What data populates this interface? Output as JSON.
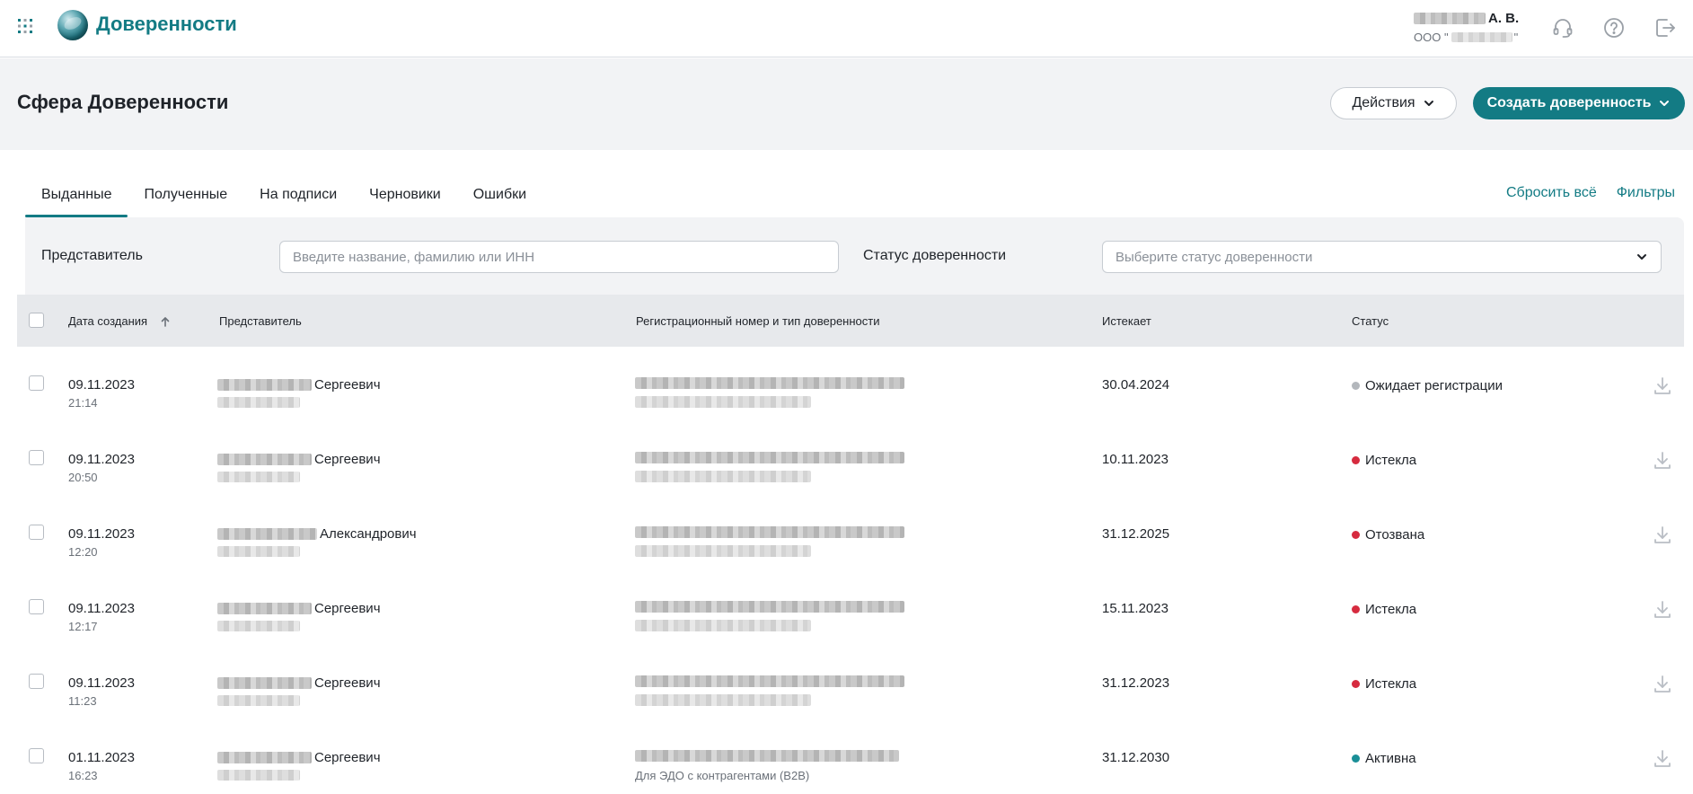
{
  "app": {
    "title": "Доверенности",
    "user_initials": "А. В.",
    "org_prefix": "ООО \""
  },
  "header": {
    "page_title": "Сфера Доверенности",
    "actions_label": "Действия",
    "create_label": "Создать доверенность"
  },
  "tabs": [
    {
      "label": "Выданные",
      "active": true
    },
    {
      "label": "Полученные",
      "active": false
    },
    {
      "label": "На подписи",
      "active": false
    },
    {
      "label": "Черновики",
      "active": false
    },
    {
      "label": "Ошибки",
      "active": false
    }
  ],
  "links": {
    "reset_all": "Сбросить всё",
    "filters": "Фильтры"
  },
  "filters": {
    "representative_label": "Представитель",
    "representative_placeholder": "Введите название, фамилию или ИНН",
    "status_label": "Статус доверенности",
    "status_placeholder": "Выберите статус доверенности"
  },
  "table": {
    "columns": {
      "created": "Дата создания",
      "representative": "Представитель",
      "reg_number": "Регистрационный номер и тип доверенности",
      "expires": "Истекает",
      "status": "Статус"
    },
    "rows": [
      {
        "date": "09.11.2023",
        "time": "21:14",
        "rep_patronymic": "Сергеевич",
        "reg_type": "",
        "expires": "30.04.2024",
        "status": "Ожидает регистрации",
        "status_color": "#b3b7bc"
      },
      {
        "date": "09.11.2023",
        "time": "20:50",
        "rep_patronymic": "Сергеевич",
        "reg_type": "",
        "expires": "10.11.2023",
        "status": "Истекла",
        "status_color": "#d62b3f"
      },
      {
        "date": "09.11.2023",
        "time": "12:20",
        "rep_patronymic": "Александрович",
        "reg_type": "",
        "expires": "31.12.2025",
        "status": "Отозвана",
        "status_color": "#d62b3f"
      },
      {
        "date": "09.11.2023",
        "time": "12:17",
        "rep_patronymic": "Сергеевич",
        "reg_type": "",
        "expires": "15.11.2023",
        "status": "Истекла",
        "status_color": "#d62b3f"
      },
      {
        "date": "09.11.2023",
        "time": "11:23",
        "rep_patronymic": "Сергеевич",
        "reg_type": "",
        "expires": "31.12.2023",
        "status": "Истекла",
        "status_color": "#d62b3f"
      },
      {
        "date": "01.11.2023",
        "time": "16:23",
        "rep_patronymic": "Сергеевич",
        "reg_type": "Для ЭДО с контрагентами (B2B)",
        "expires": "31.12.2030",
        "status": "Активна",
        "status_color": "#1a8f97"
      }
    ]
  },
  "colors": {
    "accent": "#137b84",
    "header_bg": "#f2f3f5",
    "table_head_bg": "#e7e9ec"
  },
  "icons": {
    "apps": "apps-grid-icon",
    "logo": "globe-logo-icon",
    "support": "headset-icon",
    "help": "help-circle-icon",
    "logout": "logout-icon",
    "sort": "arrow-up-icon",
    "download": "download-icon",
    "chevron": "chevron-down-icon"
  }
}
